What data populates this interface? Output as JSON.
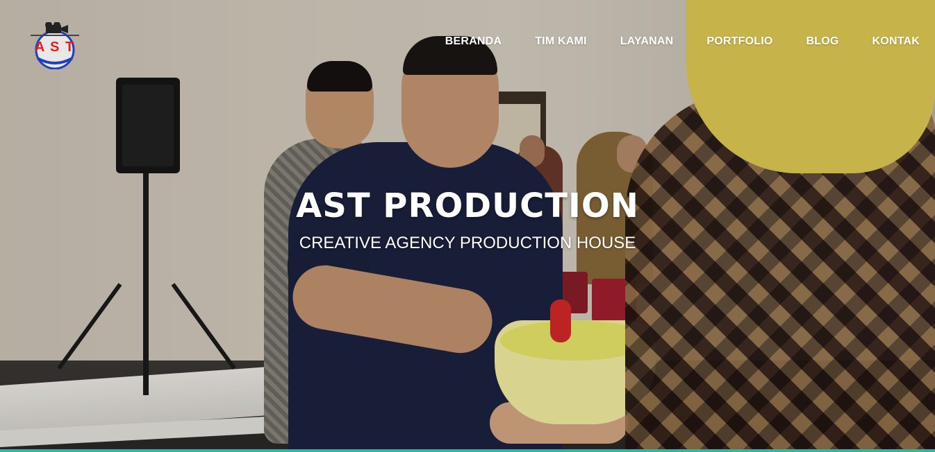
{
  "brand": {
    "logo_text": "AST",
    "colors": {
      "logo_red": "#e02020",
      "logo_blue": "#1f3fbf"
    }
  },
  "nav": {
    "items": [
      {
        "label": "BERANDA"
      },
      {
        "label": "TIM KAMI"
      },
      {
        "label": "LAYANAN"
      },
      {
        "label": "PORTFOLIO"
      },
      {
        "label": "BLOG"
      },
      {
        "label": "KONTAK"
      }
    ]
  },
  "hero": {
    "title": "AST PRODUCTION",
    "subtitle": "CREATIVE AGENCY PRODUCTION HOUSE",
    "background_description_icon": "photo-background"
  },
  "theme": {
    "accent": "#2fb7a3",
    "text_color": "#ffffff"
  }
}
